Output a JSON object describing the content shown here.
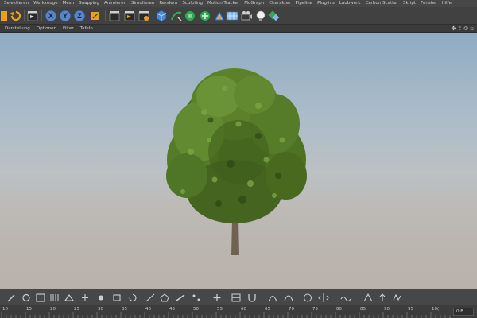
{
  "menubar": {
    "items": [
      "Selektieren",
      "Werkzeuge",
      "Mesh",
      "Snapping",
      "Animieren",
      "Simulieren",
      "Rendern",
      "Sculpting",
      "Motion Tracker",
      "MoGraph",
      "Charakter",
      "Pipeline",
      "Plug-ins",
      "Laubwerk",
      "Carbon Scatter",
      "Skript",
      "Fenster",
      "Hilfe"
    ]
  },
  "toolbar": {
    "axis_x": "X",
    "axis_y": "Y",
    "axis_z": "Z"
  },
  "viewport_menu": {
    "items": [
      "Darstellung",
      "Optionen",
      "Filter",
      "Tafeln"
    ],
    "nav_icons": [
      "move-icon",
      "zoom-icon",
      "rotate-icon",
      "maximize-icon"
    ]
  },
  "timeline": {
    "ticks": [
      "10",
      "15",
      "20",
      "25",
      "30",
      "35",
      "40",
      "45",
      "50",
      "55",
      "60",
      "65",
      "70",
      "75",
      "80",
      "85",
      "90",
      "95",
      "10("
    ],
    "current_frame": "0 B"
  },
  "colors": {
    "accent_orange": "#e8a020",
    "axis_blue": "#5a86c8",
    "green_icon": "#3aa35a"
  }
}
